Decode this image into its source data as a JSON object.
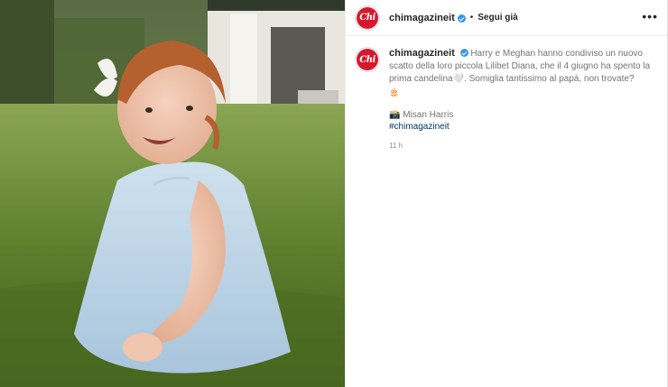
{
  "post": {
    "username": "chimagazineit",
    "avatar_text": "Chi",
    "follow_label": "Segui già",
    "dot": "•",
    "more": "•••",
    "caption": "Harry e Meghan hanno condiviso un nuovo scatto della loro piccola Lilibet Diana, che il 4 giugno ha spento la prima candelina🤍. Somiglia tantissimo al papà, non trovate?",
    "cake_emoji": "🎂",
    "credit": "📸 Misan Harris",
    "hashtag": "#chimagazineit",
    "timestamp": "11 h"
  },
  "colors": {
    "brand_red": "#d7172d",
    "link_blue": "#00376b",
    "verified_blue": "#3897f0"
  }
}
